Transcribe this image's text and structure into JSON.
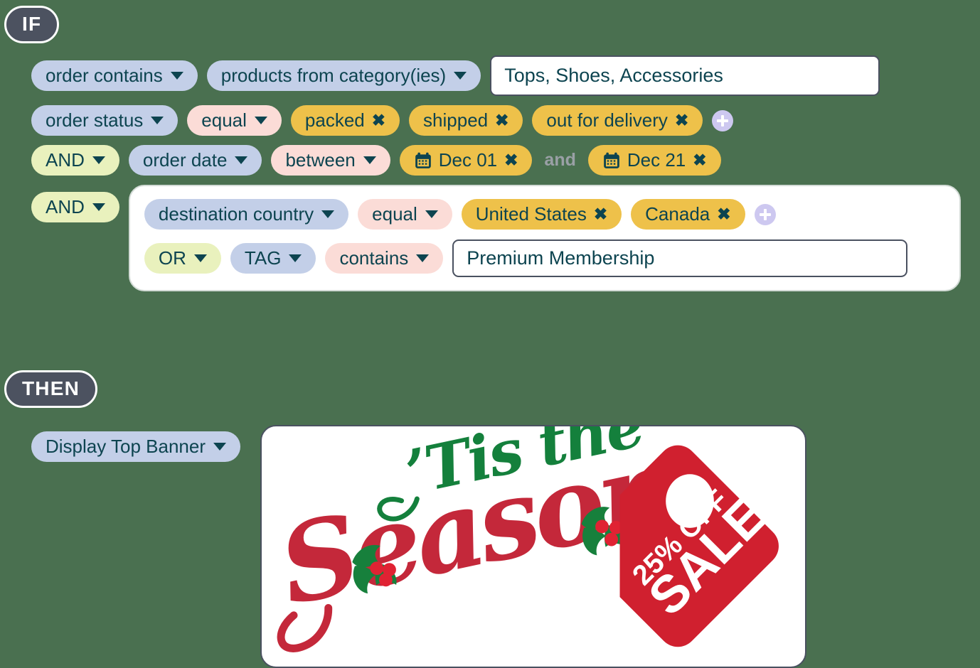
{
  "rule_builder": {
    "if_badge": "IF",
    "then_badge": "THEN",
    "and_joiner": "and",
    "icons": {
      "caret": "chevron-down-icon",
      "remove": "close-x-icon",
      "add": "plus-circle-icon",
      "calendar": "calendar-icon"
    },
    "colors": {
      "background": "#4a7050",
      "badge": "#4c5260",
      "pill_blue": "#c3cfe8",
      "pill_pink": "#fbdcd7",
      "pill_yellow": "#eec14a",
      "pill_green": "#e9f1bd",
      "add_button": "#cdc8f0",
      "text": "#0d4450",
      "banner_red": "#d0202f",
      "banner_green": "#14803c"
    },
    "conditions": [
      {
        "id": "row-1",
        "field": "order contains",
        "qualifier": "products from category(ies)",
        "value": "Tops, Shoes, Accessories"
      },
      {
        "id": "row-2",
        "field": "order status",
        "operator": "equal",
        "tags": [
          "packed",
          "shipped",
          "out for delivery"
        ]
      },
      {
        "id": "row-3",
        "logic": "AND",
        "field": "order date",
        "operator": "between",
        "date_from": "Dec 01",
        "date_to": "Dec 21"
      },
      {
        "id": "row-4",
        "logic": "AND",
        "group": [
          {
            "id": "group-row-1",
            "field": "destination country",
            "operator": "equal",
            "tags": [
              "United States",
              "Canada"
            ]
          },
          {
            "id": "group-row-2",
            "logic": "OR",
            "field": "TAG",
            "operator": "contains",
            "value": "Premium Membership"
          }
        ]
      }
    ],
    "action": {
      "type": "Display Top Banner",
      "banner": {
        "headline_script_top": "Tis the",
        "headline_script_bottom": "Season",
        "tag_discount": "25% OFF",
        "tag_word": "SALE"
      }
    }
  }
}
